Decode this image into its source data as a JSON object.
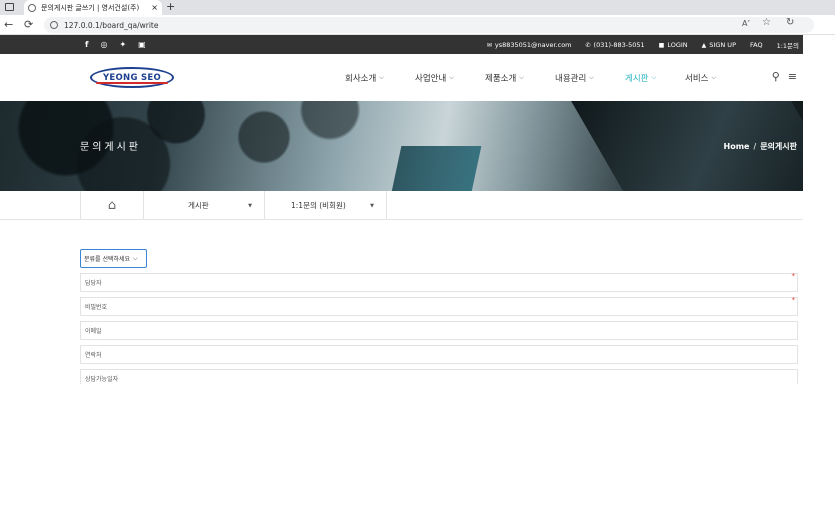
{
  "browser": {
    "tab_title": "문의게시판 글쓰기 | 영서건설(주)",
    "tab_close": "×",
    "new_tab": "+",
    "url": "127.0.0.1/board_qa/write",
    "read_aloud": "A’",
    "favorite": "☆",
    "refresh": "↻"
  },
  "topbar": {
    "social_icons": [
      "facebook-icon",
      "instagram-icon",
      "twitter-icon",
      "youtube-icon"
    ],
    "email": "ys8835051@naver.com",
    "phone": "(031)-883-5051",
    "login": "LOGIN",
    "signup": "SIGN UP",
    "faq": "FAQ",
    "one_on_one": "1:1문의"
  },
  "header": {
    "logo_text": "YEONG SEO",
    "menu": [
      {
        "label": "회사소개",
        "active": false
      },
      {
        "label": "사업안내",
        "active": false
      },
      {
        "label": "제품소개",
        "active": false
      },
      {
        "label": "내용관리",
        "active": false
      },
      {
        "label": "게시판",
        "active": true
      },
      {
        "label": "서비스",
        "active": false
      }
    ],
    "accent_color": "#2bb6c4"
  },
  "banner": {
    "title": "문의게시판",
    "crumb_home": "Home",
    "crumb_sep": "/",
    "crumb_current": "문의게시판"
  },
  "subnav": {
    "board": "게시판",
    "sub_board": "1:1문의 (비회원)"
  },
  "form": {
    "category_placeholder": "분류를 선택하세요",
    "fields": [
      {
        "label": "담당자",
        "required": true
      },
      {
        "label": "비밀번호",
        "required": true
      },
      {
        "label": "이메일",
        "required": false
      },
      {
        "label": "연락처",
        "required": false
      },
      {
        "label": "상담가능일자",
        "required": false
      }
    ],
    "required_mark": "*"
  }
}
